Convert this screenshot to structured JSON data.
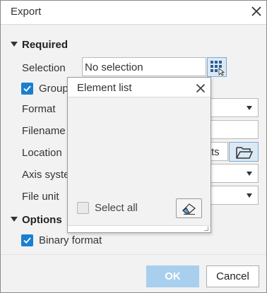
{
  "dialog": {
    "title": "Export",
    "close_icon": "close-icon"
  },
  "required": {
    "section_label": "Required",
    "selection_label": "Selection",
    "selection_value": "No selection",
    "group_label": "Group",
    "format_label": "Format",
    "filename_label": "Filename",
    "location_label": "Location",
    "location_value_fragment": "ts",
    "axis_label": "Axis syste",
    "file_unit_label": "File unit"
  },
  "options": {
    "section_label": "Options",
    "binary_label": "Binary format"
  },
  "element_list_popup": {
    "title": "Element list",
    "select_all_label": "Select all"
  },
  "footer": {
    "ok_label": "OK",
    "cancel_label": "Cancel"
  },
  "colors": {
    "accent": "#1a7fd0",
    "ok_disabled": "#a8cfee",
    "panel_bg": "#f2f2f2"
  }
}
